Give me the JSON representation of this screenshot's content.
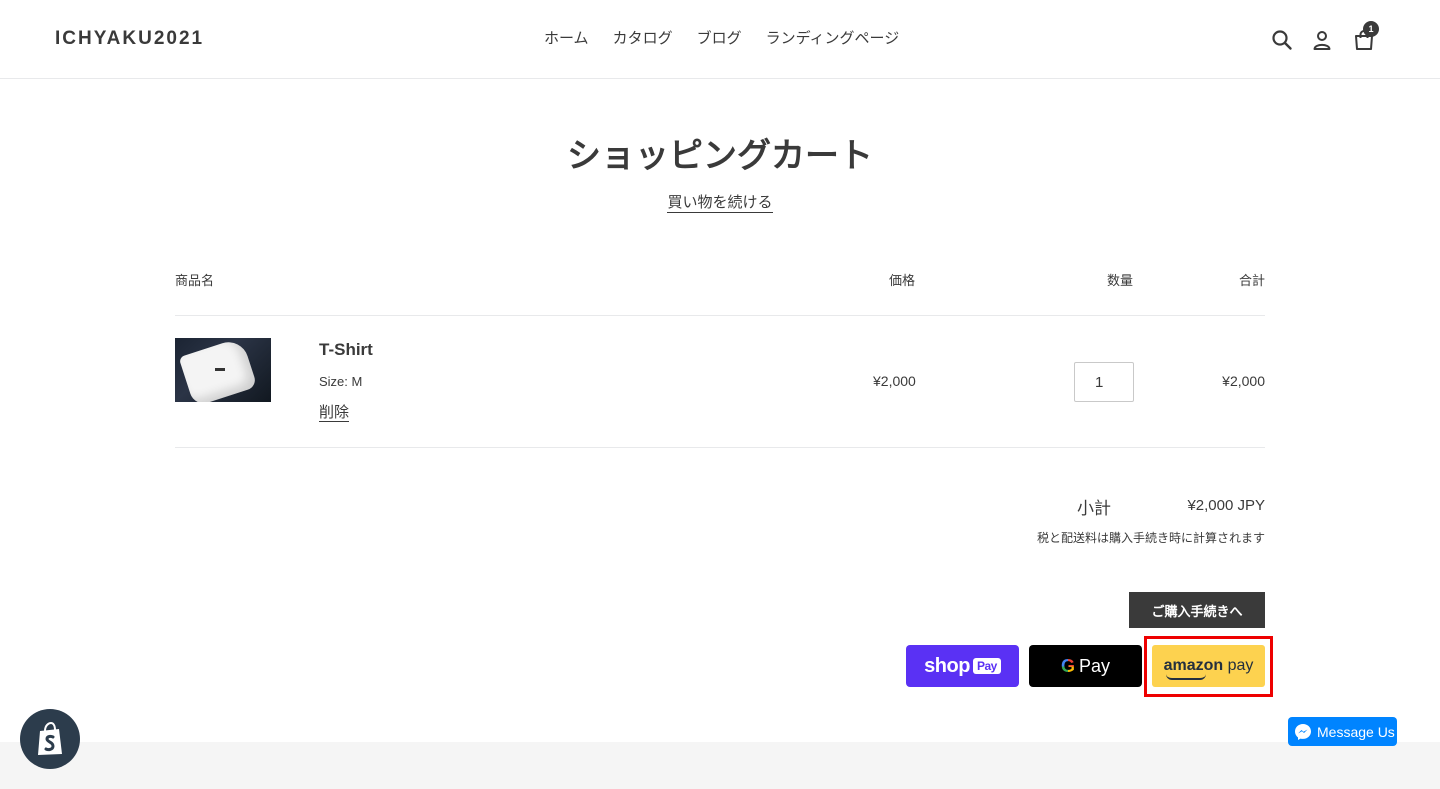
{
  "header": {
    "logo": "ICHYAKU2021",
    "nav": [
      "ホーム",
      "カタログ",
      "ブログ",
      "ランディングページ"
    ],
    "cart_count": "1"
  },
  "cart": {
    "title": "ショッピングカート",
    "continue_label": "買い物を続ける",
    "columns": {
      "product": "商品名",
      "price": "価格",
      "quantity": "数量",
      "total": "合計"
    },
    "item": {
      "name": "T-Shirt",
      "variant": "Size: M",
      "remove_label": "削除",
      "price": "¥2,000",
      "quantity": "1",
      "line_total": "¥2,000"
    },
    "subtotal_label": "小計",
    "subtotal_value": "¥2,000 JPY",
    "tax_note": "税と配送料は購入手続き時に計算されます",
    "checkout_label": "ご購入手続きへ"
  },
  "payments": {
    "shop_pay": {
      "text": "shop",
      "badge": "Pay",
      "color": "#5a31f4"
    },
    "google_pay": {
      "g": "G",
      "text": "Pay",
      "color": "#000000"
    },
    "amazon_pay": {
      "brand": "amazon",
      "text": "pay",
      "color": "#fdd24f"
    },
    "highlight_color": "#ee0000"
  },
  "messenger": {
    "label": "Message Us",
    "color": "#0084ff"
  },
  "icons": [
    "search-icon",
    "account-icon",
    "cart-icon",
    "shopify-bag-icon",
    "messenger-icon"
  ]
}
